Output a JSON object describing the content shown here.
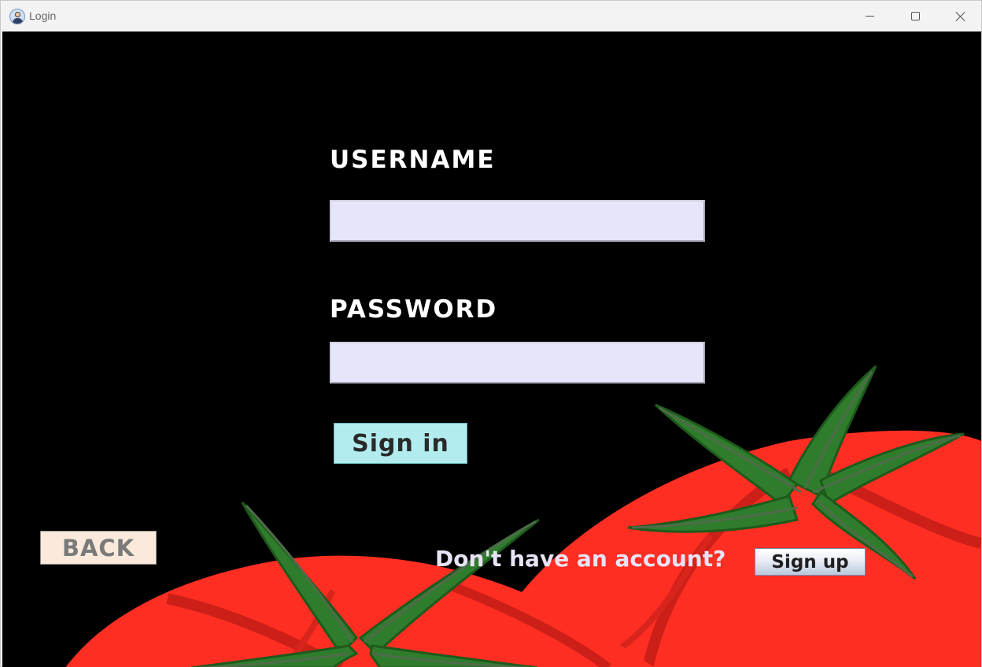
{
  "window": {
    "title": "Login",
    "app_icon": "user-avatar-icon",
    "controls": [
      "minimize-icon",
      "maximize-icon",
      "close-icon"
    ]
  },
  "form": {
    "username_label": "USERNAME",
    "username_value": "",
    "password_label": "PASSWORD",
    "password_value": "",
    "signin_label": "Sign in"
  },
  "footer": {
    "back_label": "BACK",
    "prompt": "Don't have an account?",
    "signup_label": "Sign up"
  },
  "colors": {
    "background": "#000000",
    "field_fill": "#e6e6fa",
    "signin_fill": "#b2ecee",
    "back_fill": "#fbeadb",
    "tomato_red": "#ff2e22",
    "leaf_green": "#2f7d2c"
  }
}
